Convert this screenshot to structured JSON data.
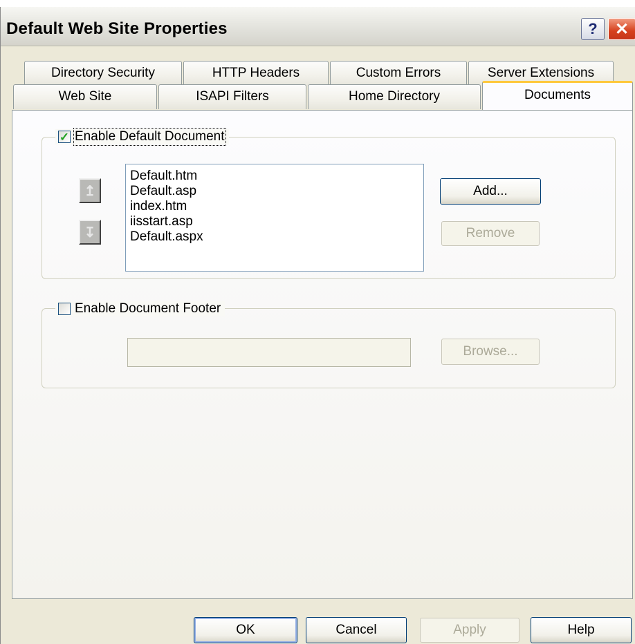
{
  "window": {
    "title": "Default Web Site Properties",
    "help_glyph": "?",
    "close_glyph": "✕"
  },
  "tabs": {
    "row1": [
      "Directory Security",
      "HTTP Headers",
      "Custom Errors",
      "Server Extensions"
    ],
    "row2": [
      "Web Site",
      "ISAPI Filters",
      "Home Directory",
      "Documents"
    ],
    "active": "Documents"
  },
  "default_document": {
    "label": "Enable Default Document",
    "checked": true,
    "items": [
      "Default.htm",
      "Default.asp",
      "index.htm",
      "iisstart.asp",
      "Default.aspx"
    ],
    "move_up_glyph": "↥",
    "move_down_glyph": "↧",
    "add_label": "Add...",
    "remove_label": "Remove"
  },
  "document_footer": {
    "label": "Enable Document Footer",
    "checked": false,
    "path_value": "",
    "browse_label": "Browse..."
  },
  "footer_buttons": {
    "ok": "OK",
    "cancel": "Cancel",
    "apply": "Apply",
    "help": "Help"
  },
  "colors": {
    "dialog_bg": "#ece9d8",
    "active_tab_accent": "#ffc83c",
    "button_border": "#003c74",
    "check_mark": "#21a121"
  }
}
